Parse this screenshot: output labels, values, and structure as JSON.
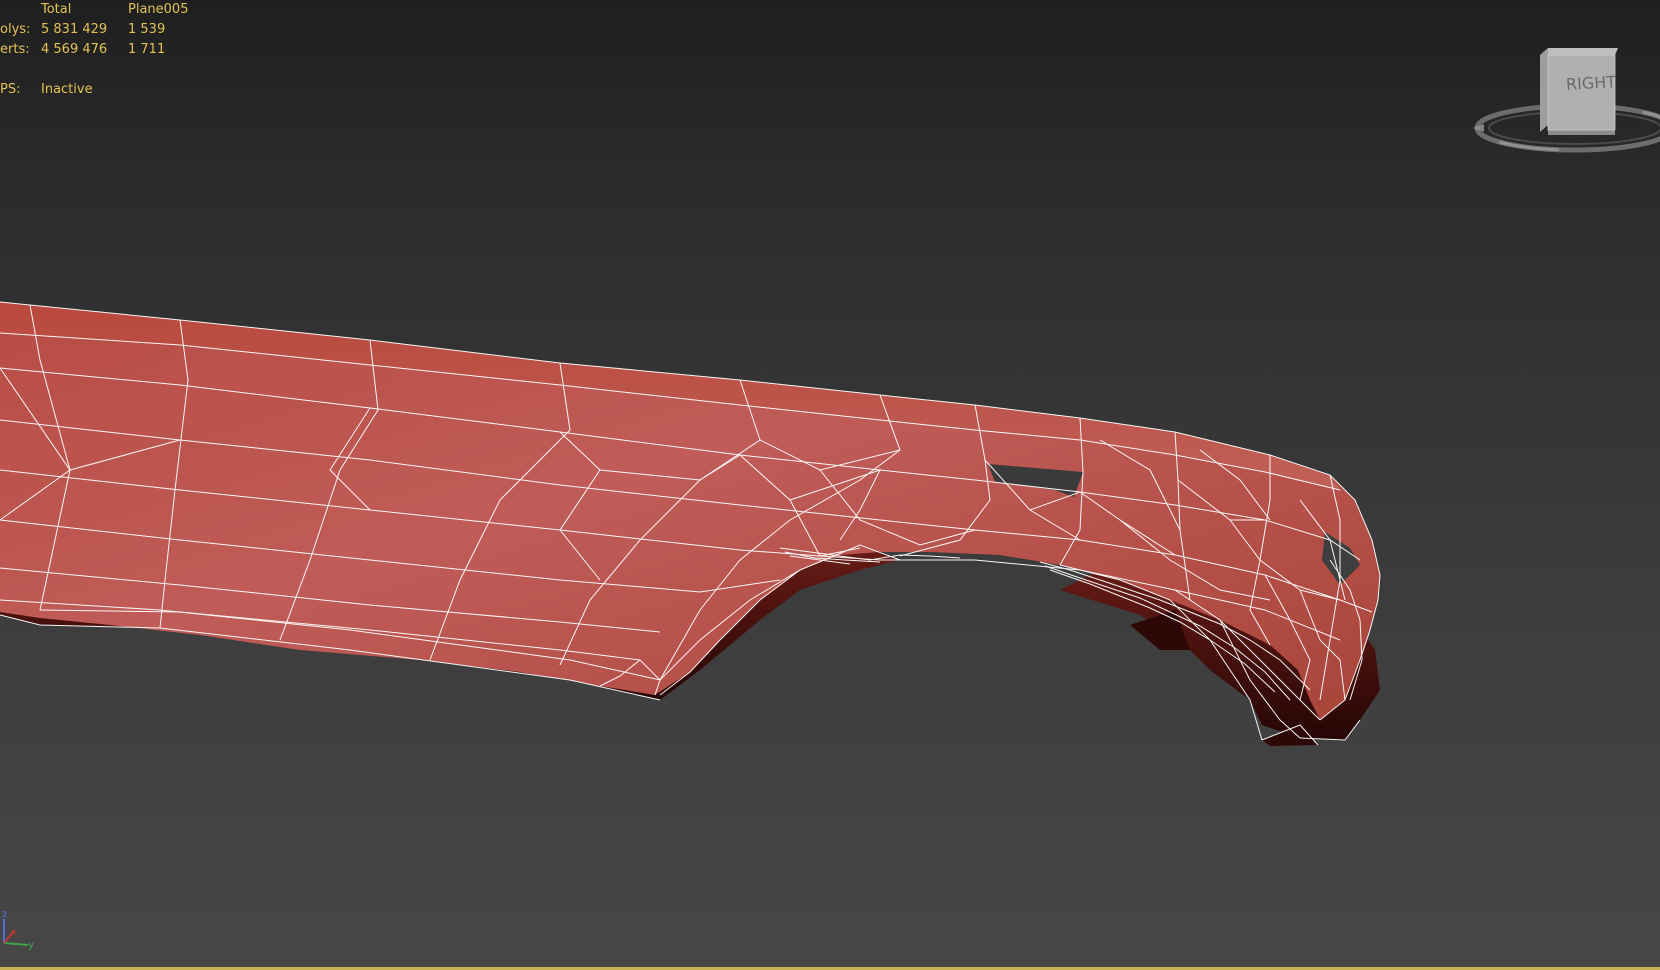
{
  "statistics": {
    "header": {
      "label": "",
      "total": "Total",
      "object": "Plane005"
    },
    "polys": {
      "label": "olys:",
      "total": "5 831 429",
      "object": "1 539"
    },
    "verts": {
      "label": "erts:",
      "total": "4 569 476",
      "object": "1 711"
    },
    "fps": {
      "label": "PS:",
      "value": "Inactive"
    }
  },
  "viewcube": {
    "face_label": "RIGHT",
    "icon": "viewcube-navigation-icon"
  },
  "axis_tripod": {
    "labels": [
      "z",
      "x",
      "y"
    ],
    "icon": "axis-tripod-icon"
  },
  "mesh": {
    "object_name": "Plane005",
    "display": "smooth + edged faces",
    "color": "#c0524a",
    "wire_color": "#ffffff"
  },
  "colors": {
    "stats_text": "#e3c253",
    "viewport_top": "#1f1f1f",
    "viewport_bottom": "#474747"
  }
}
